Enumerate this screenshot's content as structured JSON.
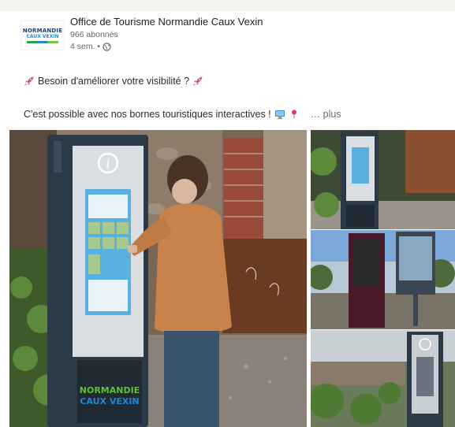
{
  "post": {
    "author": {
      "name": "Office de Tourisme Normandie Caux Vexin",
      "followers": "966 abonnés",
      "time": "4 sem. •",
      "logo_line1": "NORMANDIE",
      "logo_line2": "CAUX VEXIN"
    },
    "text": {
      "line1": "Besoin d'améliorer votre visibilité ?",
      "line2": "C'est possible avec nos bornes touristiques interactives !",
      "more": "… plus"
    },
    "kiosk_brand": {
      "line1": "NORMANDIE",
      "line2": "CAUX VEXIN"
    },
    "icons": {
      "rocket": "rocket-emoji",
      "computer": "computer-emoji",
      "pin": "pin-emoji",
      "visibility": "globe-icon"
    }
  },
  "colors": {
    "text": "#1d1d1d",
    "muted": "#666666",
    "kiosk_frame": "#2c3a47",
    "brand_green": "#5fbf3a",
    "brand_blue": "#1e88d6"
  }
}
